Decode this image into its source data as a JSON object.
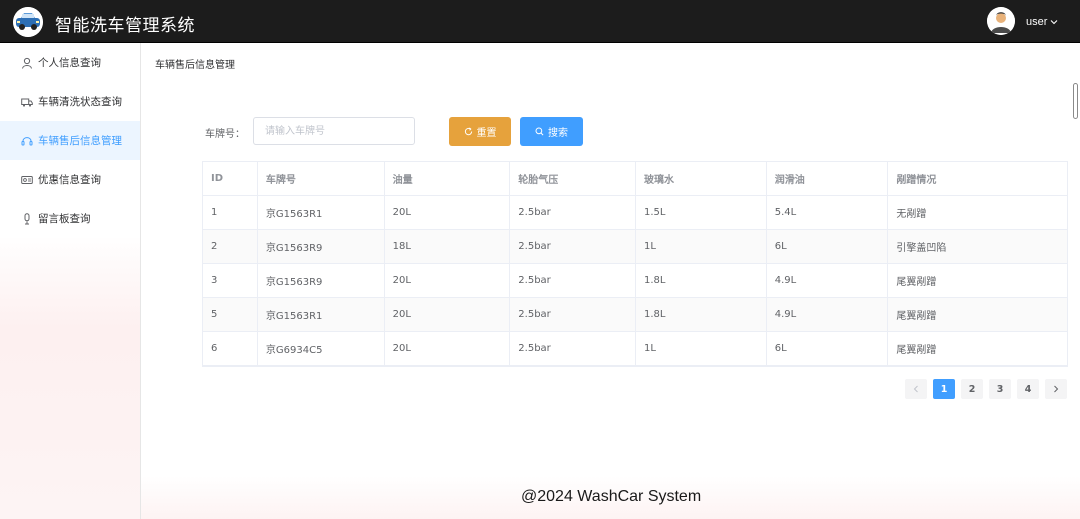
{
  "header": {
    "title": "智能洗车管理系统",
    "user_name": "user"
  },
  "sidebar": {
    "items": [
      {
        "label": "个人信息查询",
        "icon": "user-icon",
        "active": false
      },
      {
        "label": "车辆清洗状态查询",
        "icon": "truck-icon",
        "active": false
      },
      {
        "label": "车辆售后信息管理",
        "icon": "headset-icon",
        "active": true
      },
      {
        "label": "优惠信息查询",
        "icon": "ticket-icon",
        "active": false
      },
      {
        "label": "留言板查询",
        "icon": "microphone-icon",
        "active": false
      }
    ]
  },
  "breadcrumb": "车辆售后信息管理",
  "search": {
    "label": "车牌号：",
    "placeholder": "请输入车牌号",
    "reset_label": "重置",
    "search_label": "搜索"
  },
  "table": {
    "columns": [
      "ID",
      "车牌号",
      "油量",
      "轮胎气压",
      "玻璃水",
      "润滑油",
      "剐蹭情况"
    ],
    "rows": [
      [
        "1",
        "京G1563R1",
        "20L",
        "2.5bar",
        "1.5L",
        "5.4L",
        "无剐蹭"
      ],
      [
        "2",
        "京G1563R9",
        "18L",
        "2.5bar",
        "1L",
        "6L",
        "引擎盖凹陷"
      ],
      [
        "3",
        "京G1563R9",
        "20L",
        "2.5bar",
        "1.8L",
        "4.9L",
        "尾翼剐蹭"
      ],
      [
        "5",
        "京G1563R1",
        "20L",
        "2.5bar",
        "1.8L",
        "4.9L",
        "尾翼剐蹭"
      ],
      [
        "6",
        "京G6934C5",
        "20L",
        "2.5bar",
        "1L",
        "6L",
        "尾翼剐蹭"
      ]
    ]
  },
  "pagination": {
    "pages": [
      "1",
      "2",
      "3",
      "4"
    ],
    "current": "1",
    "prev_icon": "chevron-left-icon",
    "next_icon": "chevron-right-icon"
  },
  "footer": "@2024 WashCar System",
  "colors": {
    "primary": "#409eff",
    "warning": "#e6a23c",
    "header_bg": "#1c1c1c"
  }
}
